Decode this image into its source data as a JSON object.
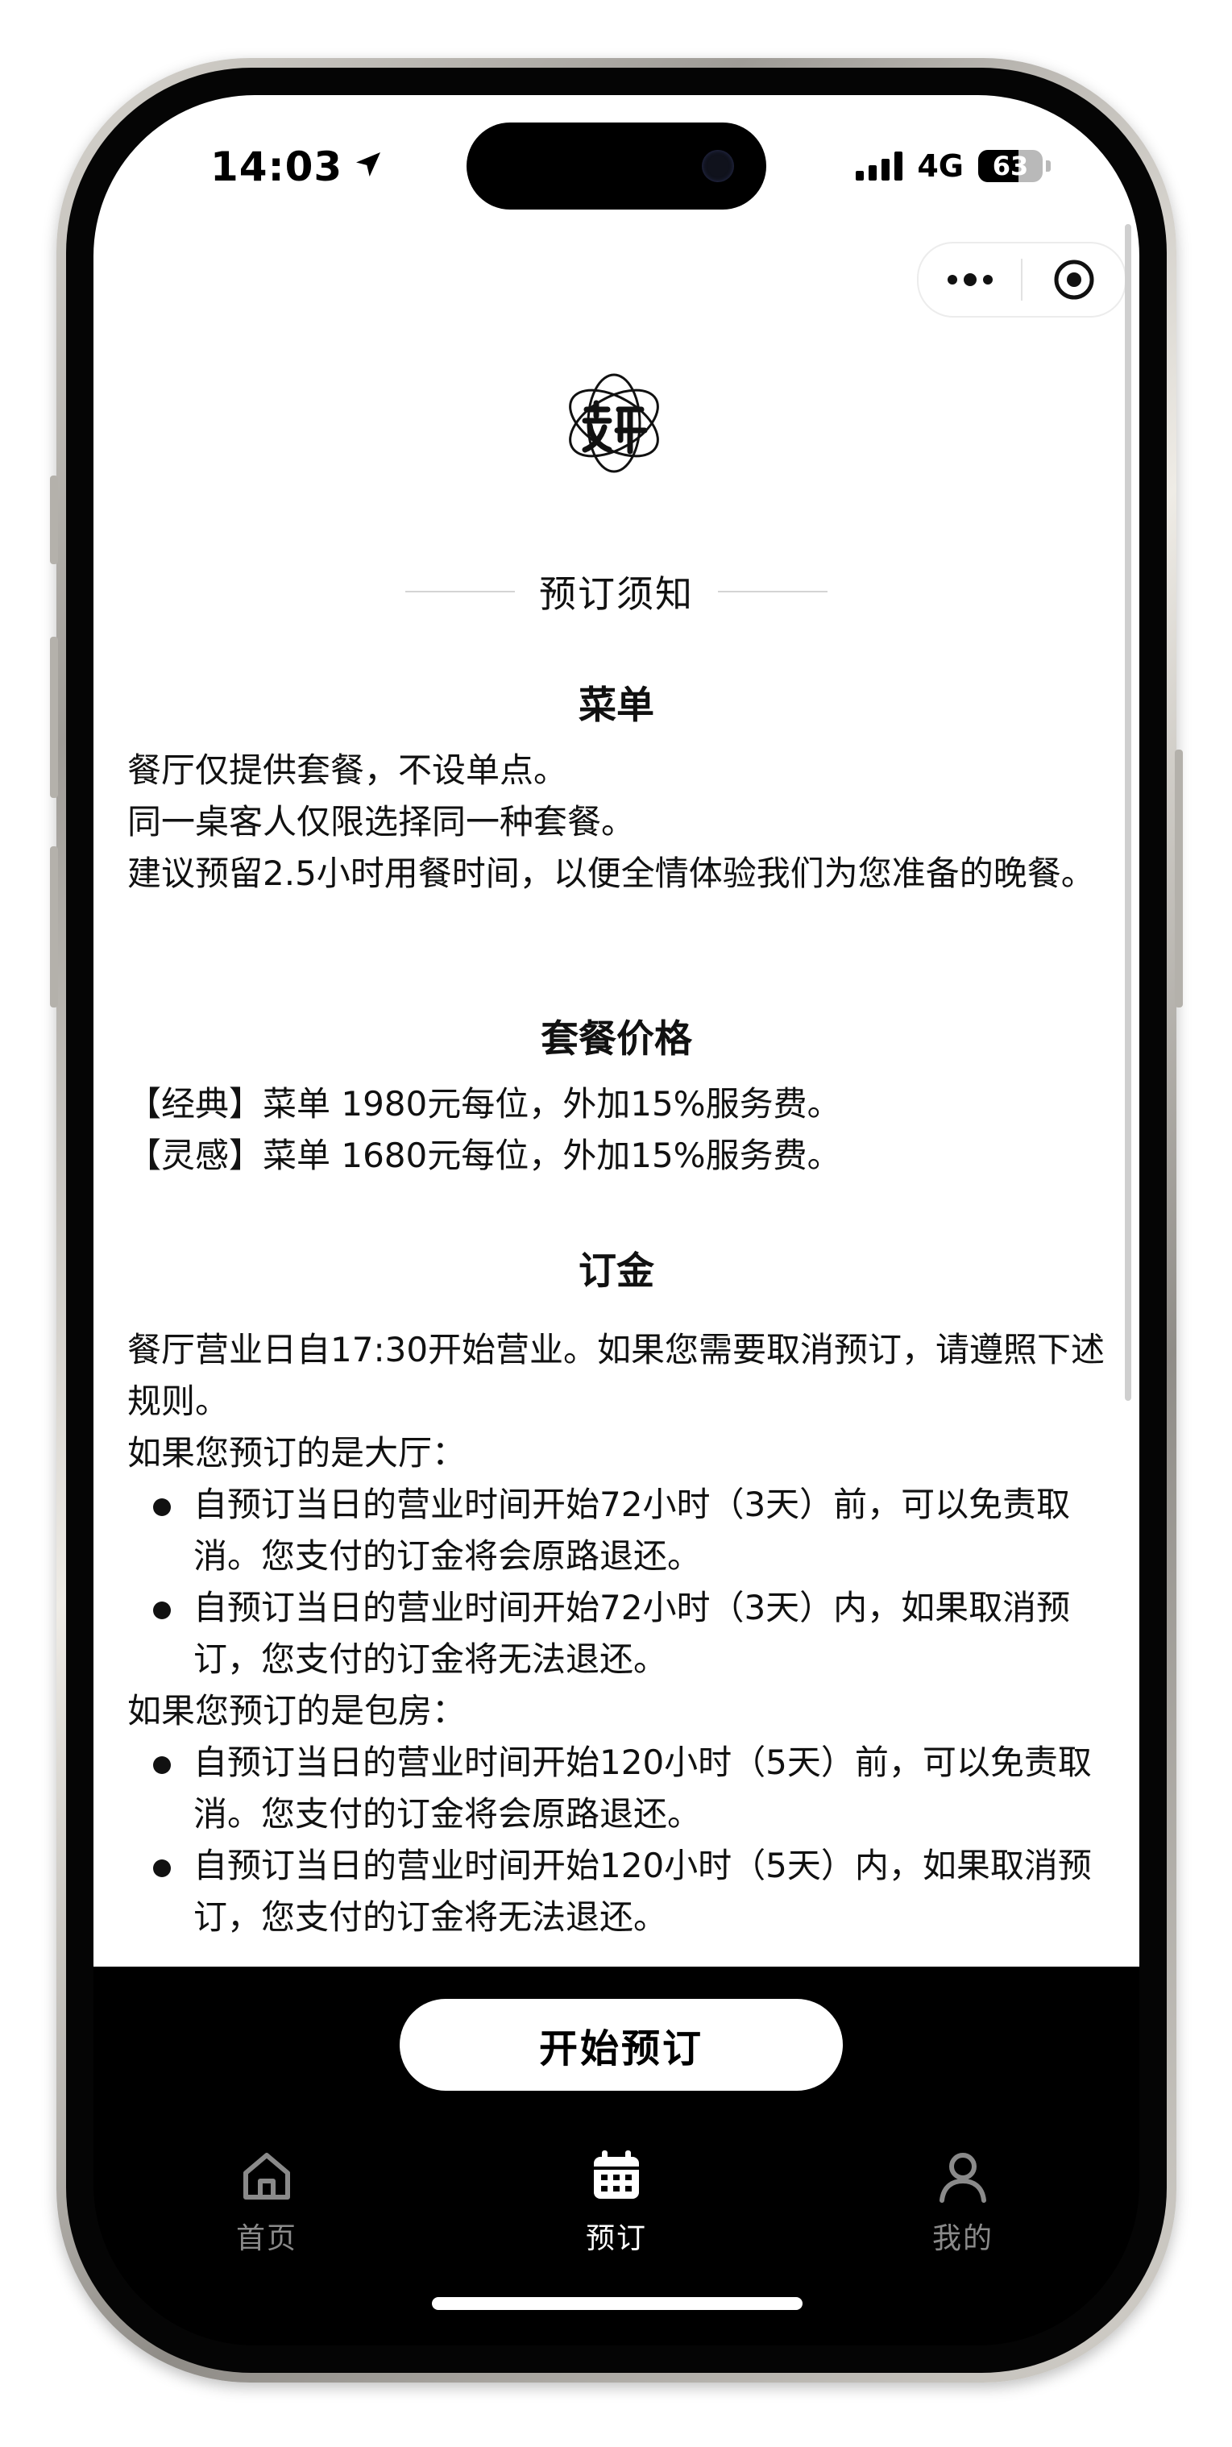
{
  "status_bar": {
    "time": "14:03",
    "network": "4G",
    "battery_percent": 63,
    "battery_text": "63"
  },
  "header": {
    "title": "预订须知"
  },
  "menu_section": {
    "title": "菜单",
    "lines": [
      "餐厅仅提供套餐，不设单点。",
      "同一桌客人仅限选择同一种套餐。",
      "建议预留2.5小时用餐时间，以便全情体验我们为您准备的晚餐。"
    ]
  },
  "price_section": {
    "title": "套餐价格",
    "lines": [
      "【经典】菜单 1980元每位，外加15%服务费。",
      "【灵感】菜单 1680元每位，外加15%服务费。"
    ]
  },
  "deposit_section": {
    "title": "订金",
    "intro": "餐厅营业日自17:30开始营业。如果您需要取消预订，请遵照下述规则。",
    "hall_label": "如果您预订的是大厅：",
    "hall_rules": [
      "自预订当日的营业时间开始72小时（3天）前，可以免责取消。您支付的订金将会原路退还。",
      "自预订当日的营业时间开始72小时（3天）内，如果取消预订，您支付的订金将无法退还。"
    ],
    "room_label": "如果您预订的是包房：",
    "room_rules": [
      "自预订当日的营业时间开始120小时（5天）前，可以免责取消。您支付的订金将会原路退还。",
      "自预订当日的营业时间开始120小时（5天）内，如果取消预订，您支付的订金将无法退还。"
    ]
  },
  "cta": {
    "label": "开始预订"
  },
  "tab_bar": {
    "items": [
      {
        "label": "首页",
        "icon": "home-icon",
        "active": false
      },
      {
        "label": "预订",
        "icon": "calendar-icon",
        "active": true
      },
      {
        "label": "我的",
        "icon": "user-icon",
        "active": false
      }
    ]
  },
  "colors": {
    "content_bg": "#ffffff",
    "bottom_bar_bg": "#000000",
    "tab_active": "#ffffff",
    "tab_inactive": "#8a8a8a"
  }
}
